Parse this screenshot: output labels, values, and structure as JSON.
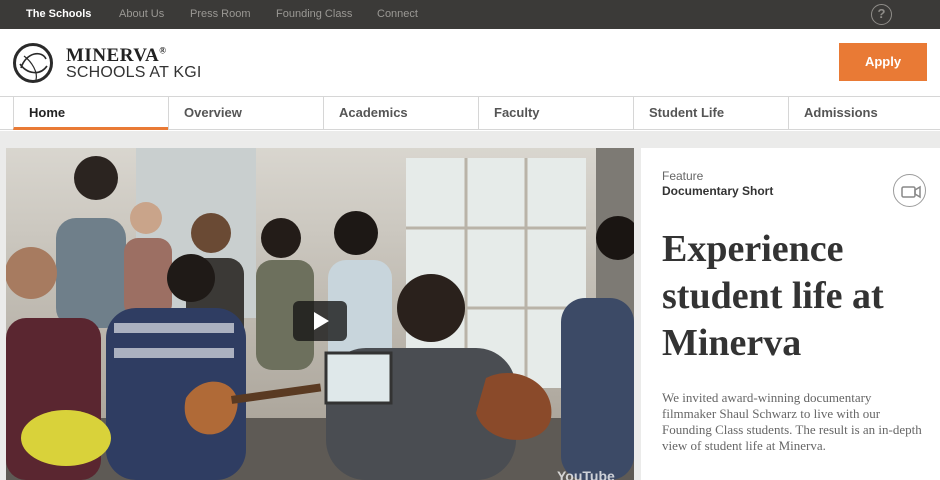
{
  "topnav": {
    "items": [
      "The Schools",
      "About Us",
      "Press Room",
      "Founding Class",
      "Connect"
    ],
    "active_index": 0,
    "help_label": "?"
  },
  "header": {
    "logo_name": "MINERVA",
    "logo_mark": "®",
    "logo_sub": "SCHOOLS AT KGI",
    "apply_label": "Apply"
  },
  "mainnav": {
    "items": [
      "Home",
      "Overview",
      "Academics",
      "Faculty",
      "Student Life",
      "Admissions"
    ],
    "active_index": 0
  },
  "video": {
    "play_icon": "play-icon",
    "watermark": "YouTube"
  },
  "feature": {
    "kicker": "Feature",
    "kicker_sub": "Documentary Short",
    "camera_icon": "video-camera-icon",
    "headline": "Experience student life at Minerva",
    "blurb": "We invited award-winning documentary filmmaker Shaul Schwarz to live with our Founding Class students. The result is an in-depth view of student life at Minerva."
  },
  "colors": {
    "accent": "#e97a35",
    "topbar_bg": "#3b3a38",
    "band_bg": "#ebebea"
  }
}
